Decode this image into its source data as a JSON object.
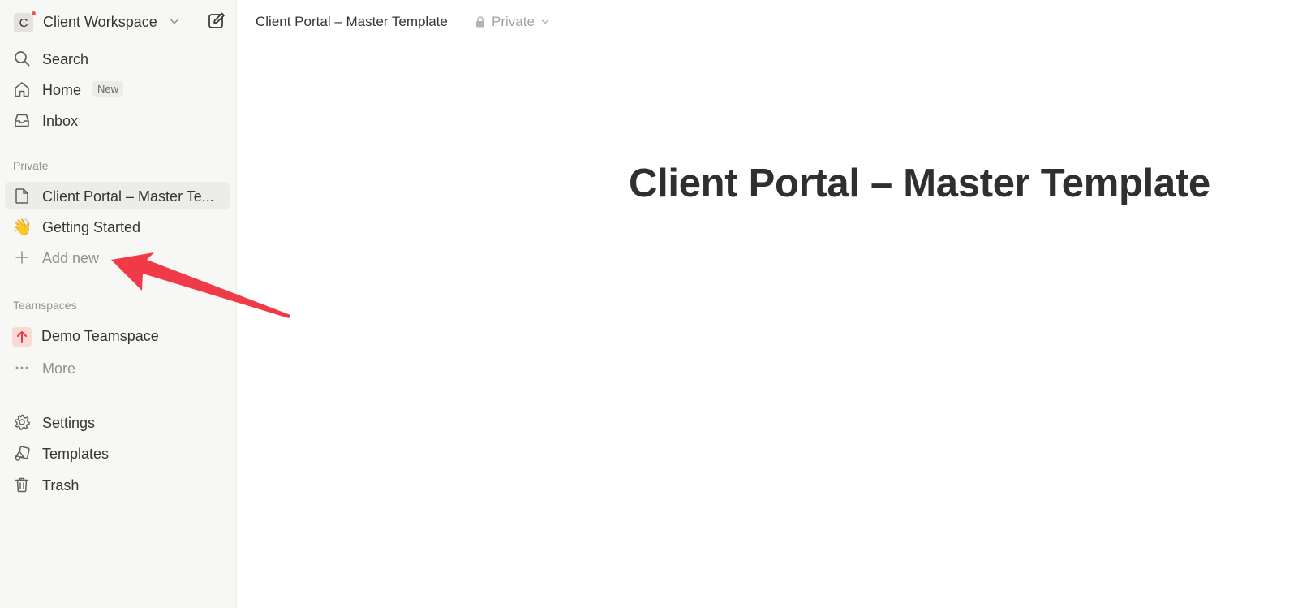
{
  "workspace": {
    "avatar_letter": "C",
    "name": "Client Workspace"
  },
  "nav": {
    "search": "Search",
    "home": "Home",
    "home_badge": "New",
    "inbox": "Inbox"
  },
  "private": {
    "label": "Private",
    "items": [
      {
        "label": "Client Portal – Master Te...",
        "icon": "page-icon"
      },
      {
        "label": "Getting Started",
        "icon": "👋"
      }
    ],
    "add_new": "Add new"
  },
  "teamspaces": {
    "label": "Teamspaces",
    "items": [
      {
        "label": "Demo Teamspace",
        "icon": "arrow-up-icon"
      }
    ],
    "more": "More"
  },
  "footer": {
    "settings": "Settings",
    "templates": "Templates",
    "trash": "Trash"
  },
  "topbar": {
    "breadcrumb": "Client Portal – Master Template",
    "privacy": "Private"
  },
  "page": {
    "title": "Client Portal – Master Template"
  },
  "colors": {
    "sidebar_bg": "#f7f7f5",
    "annotation_arrow": "#f03a47",
    "notification_dot": "#eb5757",
    "teamspace_icon_bg": "#fbd9d4",
    "teamspace_icon_fg": "#e03e3e"
  }
}
